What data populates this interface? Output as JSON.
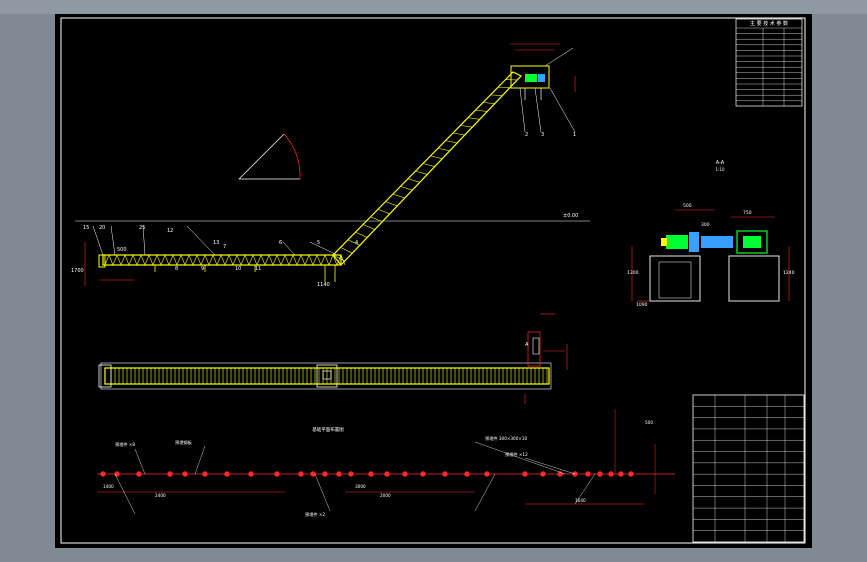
{
  "colors": {
    "viewport_bg": "#7f8a95",
    "sheet_bg": "#000000",
    "frame": "#ffffff",
    "structure": "#ffff00",
    "dimension": "#ff2a2a",
    "equipment_green": "#00ff33",
    "equipment_blue": "#3aa0ff",
    "annotation": "#ffffff"
  },
  "technical_table": {
    "title": "主 要 技 术 参 数"
  },
  "side_view": {
    "elevation_label": "±0.00",
    "dims": [
      "15",
      "20",
      "25",
      "500",
      "12",
      "13",
      "11",
      "10",
      "9",
      "8",
      "7",
      "6",
      "5",
      "4",
      "3",
      "2",
      "1",
      "1140",
      "1700"
    ]
  },
  "drive_detail": {
    "label": "A-A",
    "subtitle": "1:10",
    "dims": [
      "1300",
      "500",
      "750",
      "300",
      "1090",
      "1240"
    ]
  },
  "plan_view": {
    "label": "A"
  },
  "foundation_plan": {
    "title": "基础平面布置图",
    "hole_notes": [
      "预埋件 ×8",
      "预埋钢板",
      "预埋件 300×300×10",
      "预埋件 ×12",
      "预埋件 ×2"
    ],
    "dims": [
      "1400",
      "2400",
      "2000",
      "3000",
      "1640",
      "500"
    ]
  },
  "title_block": {
    "rows": 13
  }
}
